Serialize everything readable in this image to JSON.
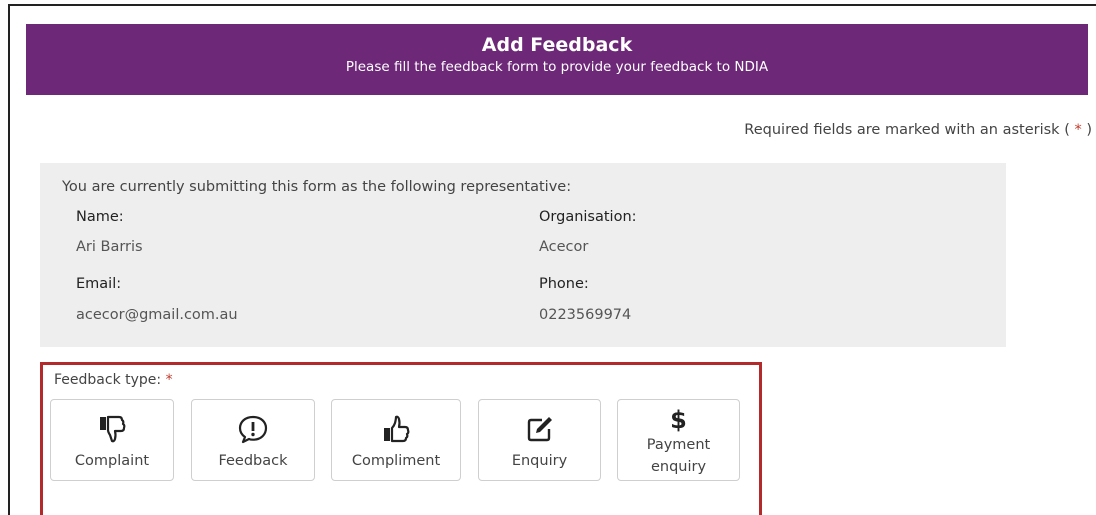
{
  "header": {
    "title": "Add Feedback",
    "subtitle": "Please fill the feedback form to provide your feedback to NDIA"
  },
  "required_note": {
    "text": "Required fields are marked with an asterisk (",
    "asterisk": "*",
    "close": ")"
  },
  "representative": {
    "intro": "You are currently submitting this form as the following representative:",
    "name_label": "Name:",
    "name_value": "Ari Barris",
    "organisation_label": "Organisation:",
    "organisation_value": "Acecor",
    "email_label": "Email:",
    "email_value": "acecor@gmail.com.au",
    "phone_label": "Phone:",
    "phone_value": "0223569974"
  },
  "feedback_type": {
    "label": "Feedback type:",
    "asterisk": "*",
    "options": [
      {
        "label": "Complaint",
        "icon": "thumbs-down-icon"
      },
      {
        "label": "Feedback",
        "icon": "speech-bubble-exclamation-icon"
      },
      {
        "label": "Compliment",
        "icon": "thumbs-up-icon"
      },
      {
        "label": "Enquiry",
        "icon": "edit-pencil-icon"
      },
      {
        "label_line1": "Payment",
        "label_line2": "enquiry",
        "icon": "dollar-icon",
        "icon_glyph": "$"
      }
    ]
  },
  "colors": {
    "header_bg": "#6d2878",
    "highlight_border": "#b22a2a",
    "asterisk": "#c0392b",
    "panel_bg": "#eeeeee"
  }
}
